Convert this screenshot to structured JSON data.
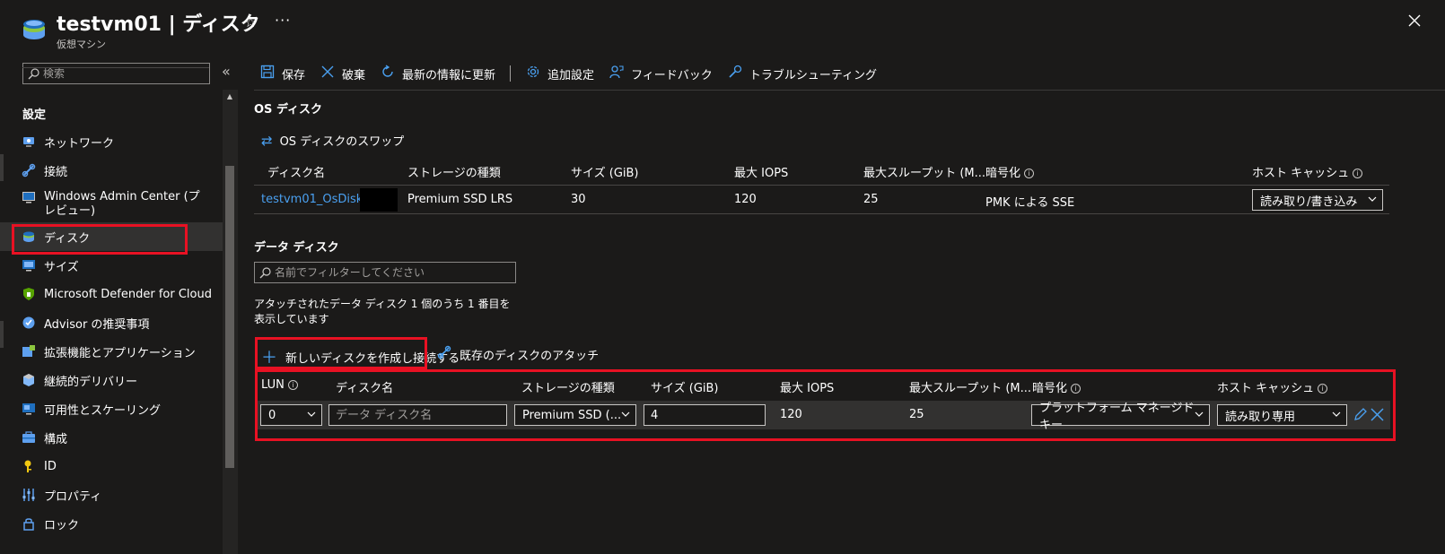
{
  "header": {
    "title": "testvm01 | ディスク",
    "subtitle": "仮想マシン",
    "icons": [
      "vm-icon",
      "star-icon",
      "more-icon",
      "close-icon"
    ]
  },
  "sidebar": {
    "search_placeholder": "検索",
    "collapse": "«",
    "section": "設定",
    "items": [
      {
        "label": "ネットワーク",
        "icon": "network-icon"
      },
      {
        "label": "接続",
        "icon": "connect-icon"
      },
      {
        "label": "Windows Admin Center (プレビュー)",
        "icon": "admin-center-icon"
      },
      {
        "label": "ディスク",
        "icon": "disk-icon",
        "selected": true
      },
      {
        "label": "サイズ",
        "icon": "size-icon"
      },
      {
        "label": "Microsoft Defender for Cloud",
        "icon": "defender-icon"
      },
      {
        "label": "Advisor の推奨事項",
        "icon": "advisor-icon"
      },
      {
        "label": "拡張機能とアプリケーション",
        "icon": "extensions-icon"
      },
      {
        "label": "継続的デリバリー",
        "icon": "delivery-icon"
      },
      {
        "label": "可用性とスケーリング",
        "icon": "availability-icon"
      },
      {
        "label": "構成",
        "icon": "configuration-icon"
      },
      {
        "label": "ID",
        "icon": "identity-icon"
      },
      {
        "label": "プロパティ",
        "icon": "properties-icon"
      },
      {
        "label": "ロック",
        "icon": "lock-icon"
      }
    ]
  },
  "toolbar": {
    "save": "保存",
    "discard": "破棄",
    "refresh": "最新の情報に更新",
    "additional_settings": "追加設定",
    "feedback": "フィードバック",
    "troubleshoot": "トラブルシューティング"
  },
  "os_disk": {
    "heading": "OS ディスク",
    "swap": "OS ディスクのスワップ",
    "columns": [
      "ディスク名",
      "ストレージの種類",
      "サイズ (GiB)",
      "最大 IOPS",
      "最大スループット (M...",
      "暗号化",
      "ホスト キャッシュ"
    ],
    "row": {
      "name": "testvm01_OsDisk_1_",
      "storage": "Premium SSD LRS",
      "size": "30",
      "iops": "120",
      "throughput": "25",
      "encryption": "PMK による SSE",
      "host_cache": "読み取り/書き込み"
    }
  },
  "data_disks": {
    "heading": "データ ディスク",
    "filter_placeholder": "名前でフィルターしてください",
    "count_text": "アタッチされたデータ ディスク 1 個のうち 1 番目を表示しています",
    "create_attach": "新しいディスクを作成し接続する",
    "attach_existing": "既存のディスクのアタッチ",
    "columns": [
      "LUN",
      "ディスク名",
      "ストレージの種類",
      "サイズ (GiB)",
      "最大 IOPS",
      "最大スループット (M...",
      "暗号化",
      "ホスト キャッシュ"
    ],
    "row": {
      "lun": "0",
      "name_placeholder": "データ ディスク名",
      "storage": "Premium SSD (...",
      "size": "4",
      "iops": "120",
      "throughput": "25",
      "encryption": "プラットフォーム マネージド キー",
      "host_cache": "読み取り専用"
    }
  },
  "colors": {
    "background": "#1b1a19",
    "accent": "#4aa0f0",
    "highlight_red": "#e81123",
    "selected_bg": "#323130"
  }
}
